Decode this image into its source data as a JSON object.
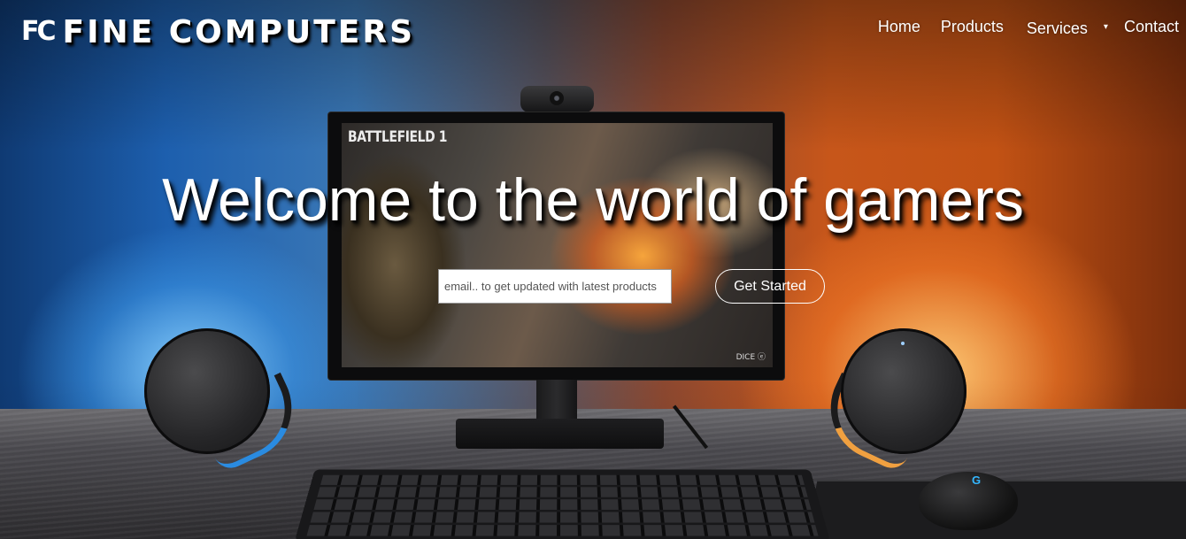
{
  "header": {
    "logo_mark": "FC",
    "logo_text": "FINE COMPUTERS",
    "nav": {
      "home": "Home",
      "products": "Products",
      "services": "Services",
      "services_caret": "▾",
      "contact": "Contact"
    }
  },
  "hero": {
    "title": "Welcome to the world of gamers",
    "email_placeholder": "email.. to get updated with latest products",
    "cta_label": "Get Started"
  },
  "background": {
    "monitor_game_title": "BATTLEFIELD 1",
    "monitor_logos": "DICE ⓔ"
  },
  "colors": {
    "wall_left": "#1d5fae",
    "wall_right": "#c25214",
    "text": "#ffffff"
  }
}
